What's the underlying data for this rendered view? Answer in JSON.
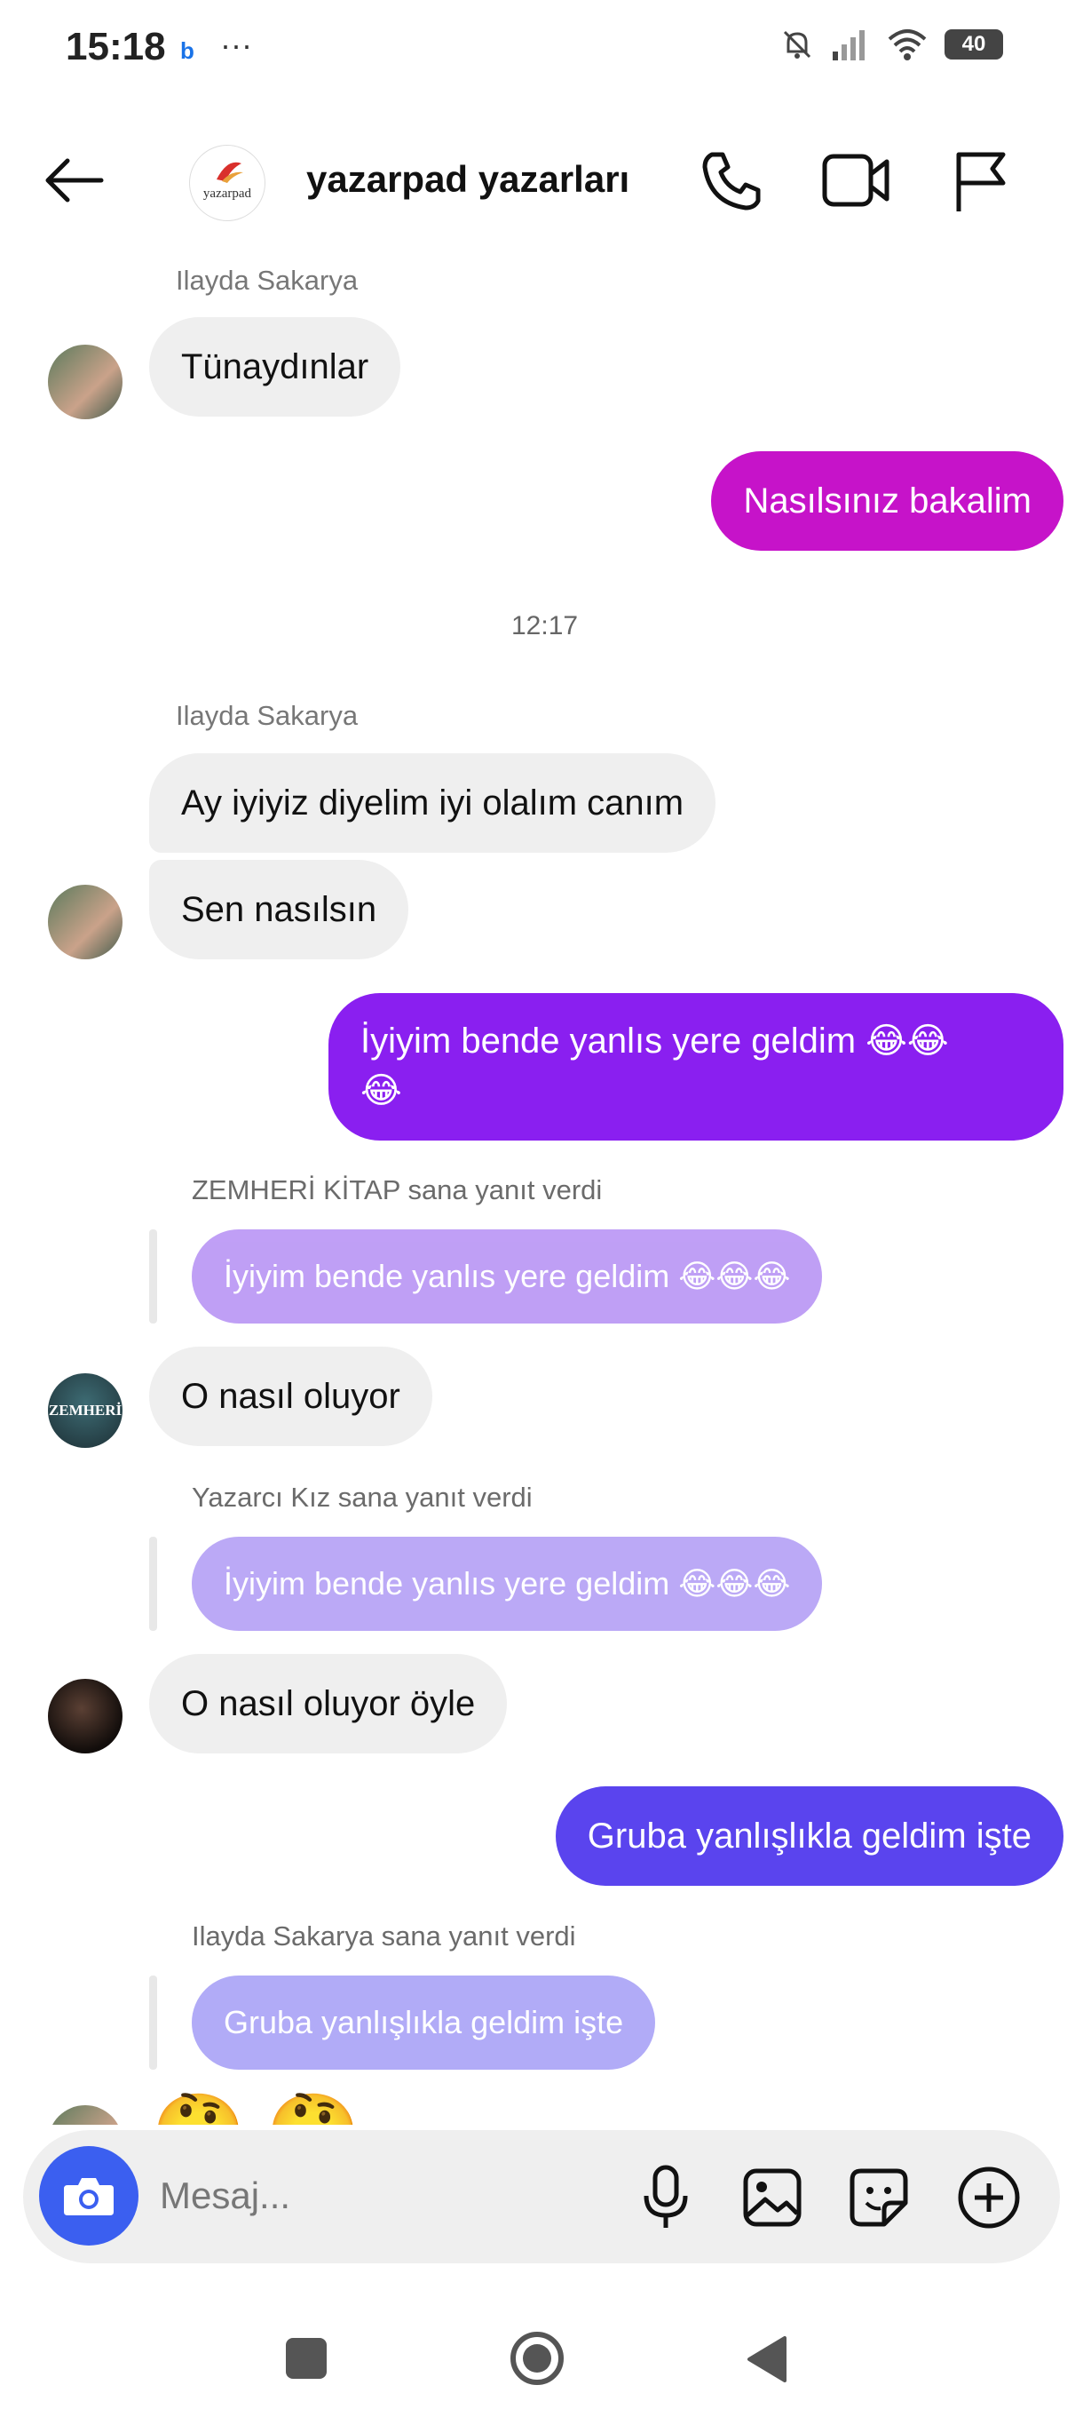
{
  "status_bar": {
    "time": "15:18",
    "battery": "40",
    "app_icon": "b",
    "overflow": "···"
  },
  "header": {
    "title": "yazarpad yazarları",
    "avatar_text": "yazarpad",
    "back_icon": "back-arrow-icon",
    "call_icon": "phone-icon",
    "video_icon": "video-icon",
    "report_icon": "flag-icon"
  },
  "messages": {
    "m1_sender": "Ilayda Sakarya",
    "m1_text": "Tünaydınlar",
    "m2_text": "Nasılsınız bakalim",
    "time_divider": "12:17",
    "m3_sender": "Ilayda Sakarya",
    "m3_text": "Ay iyiyiz diyelim iyi olalım canım",
    "m4_text": "Sen nasılsın",
    "m5_text": "İyiyim bende yanlıs yere geldim 😂😂",
    "m5_text2": "😂",
    "r1_label": "ZEMHERİ KİTAP sana yanıt verdi",
    "r1_quote": "İyiyim bende yanlıs yere geldim 😂😂😂",
    "m6_text": "O nasıl oluyor",
    "r2_label": "Yazarcı Kız sana yanıt verdi",
    "r2_quote": "İyiyim bende yanlıs yere geldim 😂😂😂",
    "m7_text": "O nasıl oluyor öyle",
    "m8_text": "Gruba yanlışlıkla geldim işte",
    "r3_label": "Ilayda Sakarya sana yanıt verdi",
    "r3_quote": "Gruba yanlışlıkla geldim işte",
    "m9_emoji": "🤔",
    "zemheri_avatar_text": "ZEMHERİ"
  },
  "composer": {
    "placeholder": "Mesaj...",
    "icons": [
      "camera-icon",
      "microphone-icon",
      "gallery-icon",
      "sticker-icon",
      "plus-icon"
    ]
  },
  "colors": {
    "out_magenta": "#c613c9",
    "out_purple": "#8a1ff0",
    "out_indigo": "#5a44ee",
    "reply_lilac": "#b995f5",
    "reply_indigo": "#a9a3f7",
    "camera_blue": "#3b5ff0"
  }
}
